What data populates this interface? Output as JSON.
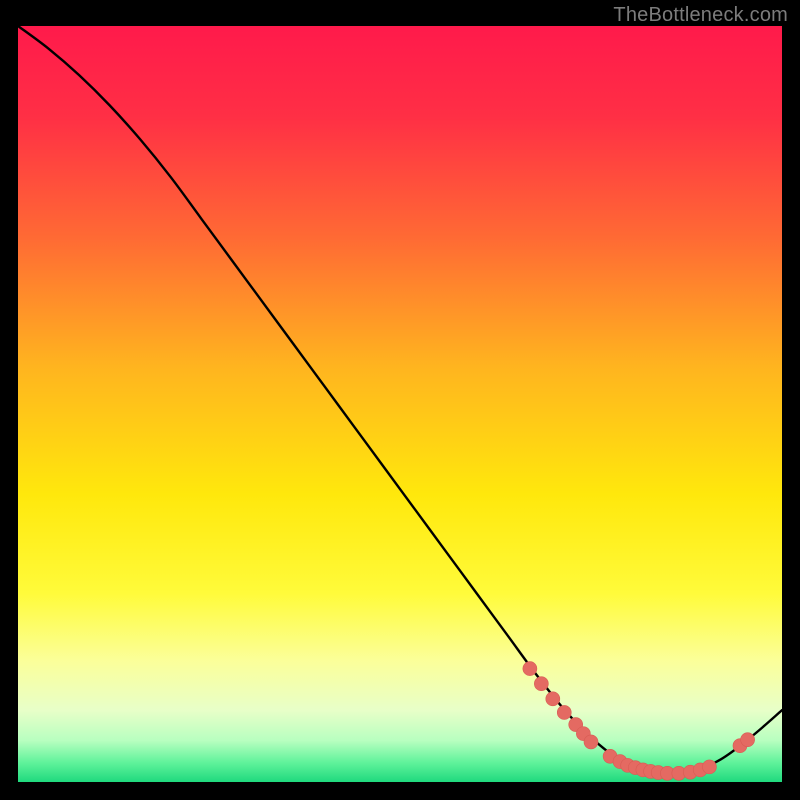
{
  "attribution": "TheBottleneck.com",
  "colors": {
    "gradient_stops": [
      {
        "offset": 0.0,
        "color": "#ff1a4b"
      },
      {
        "offset": 0.12,
        "color": "#ff2f45"
      },
      {
        "offset": 0.28,
        "color": "#ff6a34"
      },
      {
        "offset": 0.45,
        "color": "#ffb41f"
      },
      {
        "offset": 0.62,
        "color": "#ffe80c"
      },
      {
        "offset": 0.75,
        "color": "#fffb3a"
      },
      {
        "offset": 0.84,
        "color": "#fbff9a"
      },
      {
        "offset": 0.905,
        "color": "#e8ffc8"
      },
      {
        "offset": 0.945,
        "color": "#b8ffc0"
      },
      {
        "offset": 0.975,
        "color": "#5ef29a"
      },
      {
        "offset": 1.0,
        "color": "#1fd97e"
      }
    ],
    "curve": "#000000",
    "marker_fill": "#e46a62",
    "marker_stroke": "#d85c54",
    "frame": "#000000"
  },
  "chart_data": {
    "type": "line",
    "title": "",
    "xlabel": "",
    "ylabel": "",
    "xlim": [
      0,
      100
    ],
    "ylim": [
      0,
      100
    ],
    "grid": false,
    "legend": false,
    "series": [
      {
        "name": "curve",
        "x": [
          0,
          4,
          8,
          12,
          16,
          20,
          24,
          28,
          32,
          36,
          40,
          44,
          48,
          52,
          56,
          60,
          64,
          68,
          72,
          76,
          80,
          84,
          88,
          92,
          96,
          100
        ],
        "y": [
          100,
          97,
          93.5,
          89.5,
          85,
          80,
          74.5,
          69,
          63.5,
          58,
          52.5,
          47,
          41.5,
          36,
          30.5,
          25,
          19.5,
          14,
          9,
          5,
          2.2,
          1.1,
          1.3,
          3.0,
          6.0,
          9.5
        ]
      }
    ],
    "markers": [
      {
        "x": 67.0,
        "y": 15.0
      },
      {
        "x": 68.5,
        "y": 13.0
      },
      {
        "x": 70.0,
        "y": 11.0
      },
      {
        "x": 71.5,
        "y": 9.2
      },
      {
        "x": 73.0,
        "y": 7.6
      },
      {
        "x": 74.0,
        "y": 6.4
      },
      {
        "x": 75.0,
        "y": 5.3
      },
      {
        "x": 77.5,
        "y": 3.4
      },
      {
        "x": 78.8,
        "y": 2.7
      },
      {
        "x": 79.8,
        "y": 2.2
      },
      {
        "x": 80.8,
        "y": 1.9
      },
      {
        "x": 81.8,
        "y": 1.6
      },
      {
        "x": 82.8,
        "y": 1.4
      },
      {
        "x": 83.8,
        "y": 1.25
      },
      {
        "x": 85.0,
        "y": 1.15
      },
      {
        "x": 86.5,
        "y": 1.15
      },
      {
        "x": 88.0,
        "y": 1.3
      },
      {
        "x": 89.3,
        "y": 1.6
      },
      {
        "x": 90.5,
        "y": 2.0
      },
      {
        "x": 94.5,
        "y": 4.8
      },
      {
        "x": 95.5,
        "y": 5.6
      }
    ],
    "marker_radius_px": 7
  }
}
